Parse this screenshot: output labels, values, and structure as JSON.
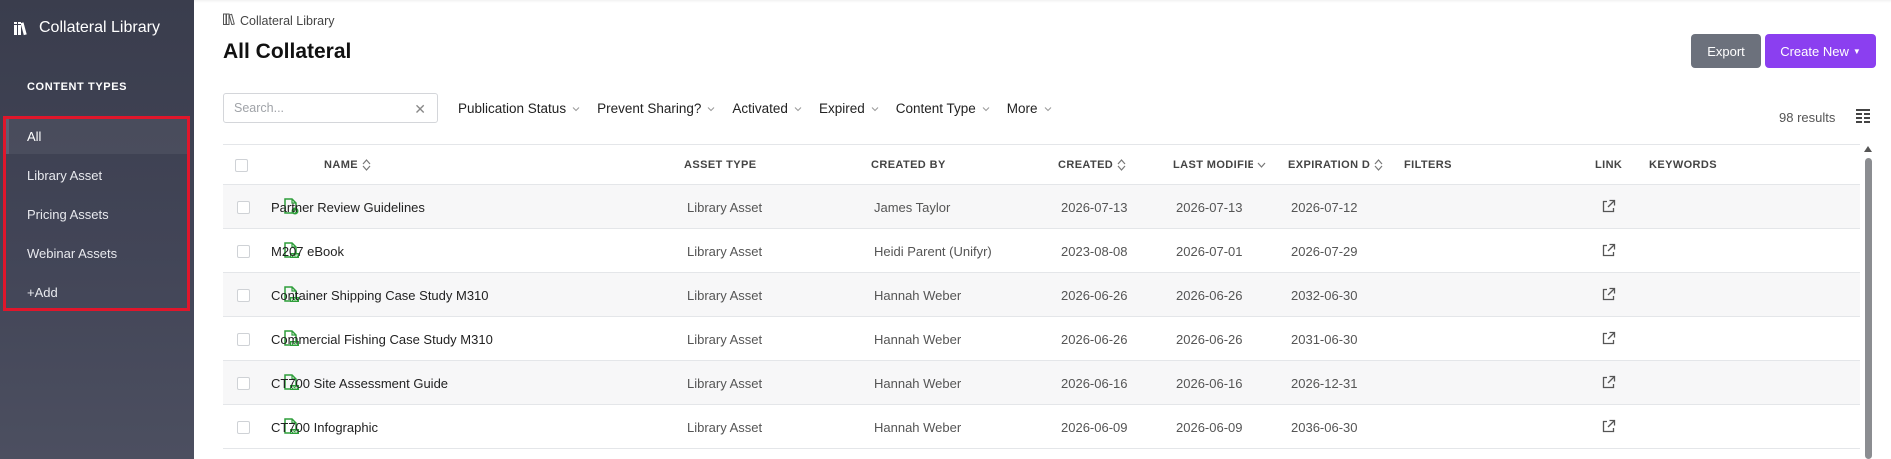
{
  "sidebar": {
    "brand": "Collateral Library",
    "section_label": "CONTENT TYPES",
    "items": [
      {
        "label": "All",
        "active": true
      },
      {
        "label": "Library Asset"
      },
      {
        "label": "Pricing Assets"
      },
      {
        "label": "Webinar Assets"
      },
      {
        "label": "+Add"
      }
    ],
    "highlight_color": "#e0162b"
  },
  "header": {
    "breadcrumb": "Collateral Library",
    "title": "All Collateral",
    "export_label": "Export",
    "create_label": "Create New",
    "create_color": "#8b3ff0",
    "export_color": "#6c717c"
  },
  "toolbar": {
    "search_placeholder": "Search...",
    "filters": [
      "Publication Status",
      "Prevent Sharing?",
      "Activated",
      "Expired",
      "Content Type",
      "More"
    ],
    "results": "98 results"
  },
  "table": {
    "columns": {
      "name": "NAME",
      "asset_type": "ASSET TYPE",
      "created_by": "CREATED BY",
      "created": "CREATED",
      "last_modified": "LAST MODIFIE",
      "expiration": "EXPIRATION D",
      "filters": "FILTERS",
      "link": "LINK",
      "keywords": "KEYWORDS"
    },
    "rows": [
      {
        "name": "Partner Review Guidelines",
        "asset_type": "Library Asset",
        "created_by": "James Taylor",
        "created": "2026-07-13",
        "last_modified": "2026-07-13",
        "expiration": "2026-07-12",
        "icon": "file-check-icon"
      },
      {
        "name": "M207 eBook",
        "asset_type": "Library Asset",
        "created_by": "Heidi Parent (Unifyr)",
        "created": "2023-08-08",
        "last_modified": "2026-07-01",
        "expiration": "2026-07-29",
        "icon": "file-pdf-icon"
      },
      {
        "name": "Container Shipping Case Study M310",
        "asset_type": "Library Asset",
        "created_by": "Hannah Weber",
        "created": "2026-06-26",
        "last_modified": "2026-06-26",
        "expiration": "2032-06-30",
        "icon": "file-pdf-icon"
      },
      {
        "name": "Commercial Fishing Case Study M310",
        "asset_type": "Library Asset",
        "created_by": "Hannah Weber",
        "created": "2026-06-26",
        "last_modified": "2026-06-26",
        "expiration": "2031-06-30",
        "icon": "file-pdf-icon"
      },
      {
        "name": "CT700 Site Assessment Guide",
        "asset_type": "Library Asset",
        "created_by": "Hannah Weber",
        "created": "2026-06-16",
        "last_modified": "2026-06-16",
        "expiration": "2026-12-31",
        "icon": "file-pdf-icon"
      },
      {
        "name": "CT700 Infographic",
        "asset_type": "Library Asset",
        "created_by": "Hannah Weber",
        "created": "2026-06-09",
        "last_modified": "2026-06-09",
        "expiration": "2036-06-30",
        "icon": "file-pdf-icon"
      }
    ]
  }
}
